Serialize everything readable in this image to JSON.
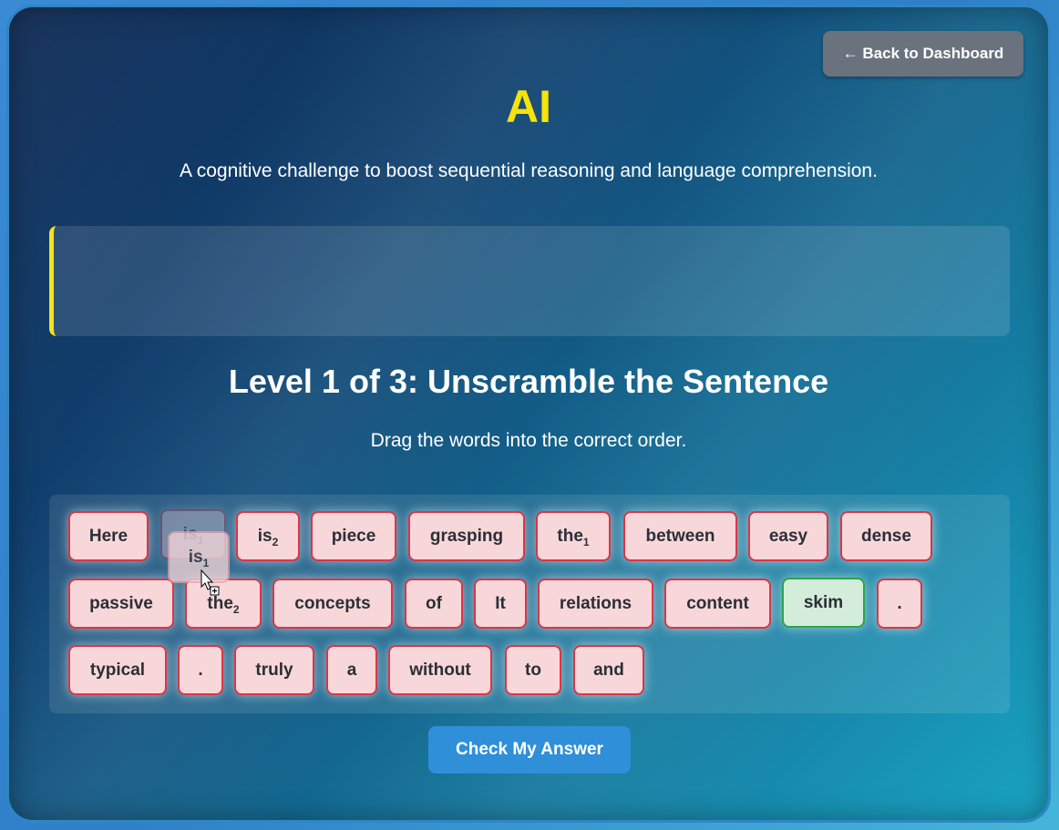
{
  "header": {
    "back_label": "← Back to Dashboard",
    "title": "AI",
    "subtitle": "A cognitive challenge to boost sequential reasoning and language comprehension."
  },
  "level": {
    "title": "Level 1 of 3: Unscramble the Sentence",
    "instructions": "Drag the words into the correct order."
  },
  "words": [
    {
      "text": "Here",
      "sub": ""
    },
    {
      "text": "is",
      "sub": "1"
    },
    {
      "text": "is",
      "sub": "2"
    },
    {
      "text": "piece",
      "sub": ""
    },
    {
      "text": "grasping",
      "sub": ""
    },
    {
      "text": "the",
      "sub": "1"
    },
    {
      "text": "between",
      "sub": ""
    },
    {
      "text": "easy",
      "sub": ""
    },
    {
      "text": "dense",
      "sub": ""
    },
    {
      "text": "passive",
      "sub": ""
    },
    {
      "text": "the",
      "sub": "2"
    },
    {
      "text": "concepts",
      "sub": ""
    },
    {
      "text": "of",
      "sub": ""
    },
    {
      "text": "It",
      "sub": ""
    },
    {
      "text": "relations",
      "sub": ""
    },
    {
      "text": "content",
      "sub": ""
    },
    {
      "text": "skim",
      "sub": ""
    },
    {
      "text": ".",
      "sub": ""
    },
    {
      "text": "typical",
      "sub": ""
    },
    {
      "text": ".",
      "sub": ""
    },
    {
      "text": "truly",
      "sub": ""
    },
    {
      "text": "a",
      "sub": ""
    },
    {
      "text": "without",
      "sub": ""
    },
    {
      "text": "to",
      "sub": ""
    },
    {
      "text": "and",
      "sub": ""
    }
  ],
  "drag_ghost": {
    "text": "is",
    "sub": "1"
  },
  "check_label": "Check My Answer",
  "colors": {
    "title": "#f6e30a",
    "chip_bg": "#f8d7da",
    "chip_border": "#dc3545",
    "chip_correct_bg": "#d4edda",
    "chip_correct_border": "#28a745",
    "accent_bar": "#f3e418",
    "check_button": "#2f8fd8",
    "back_button": "#6a737d"
  },
  "icons": {
    "cursor": "drag-copy-cursor-icon"
  }
}
